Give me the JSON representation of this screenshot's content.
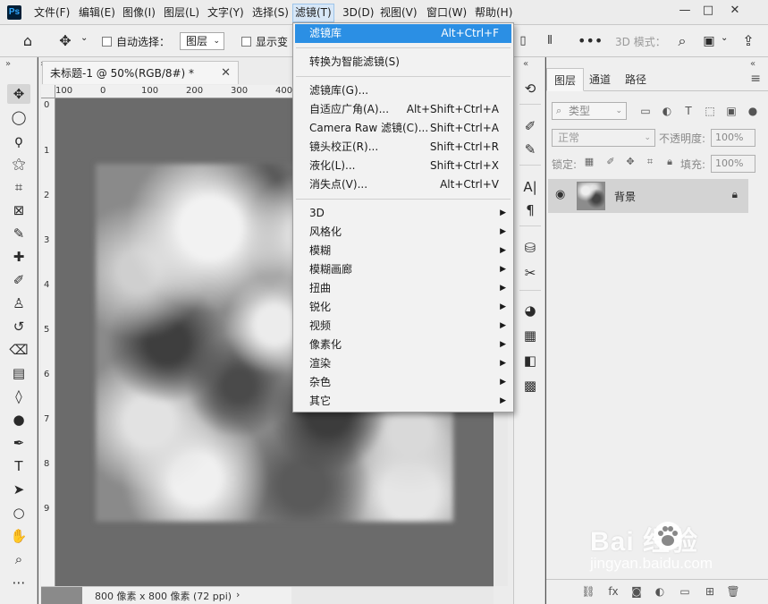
{
  "app": {
    "logo": "Ps"
  },
  "menubar": {
    "items": [
      "文件(F)",
      "编辑(E)",
      "图像(I)",
      "图层(L)",
      "文字(Y)",
      "选择(S)",
      "滤镜(T)",
      "3D(D)",
      "视图(V)",
      "窗口(W)",
      "帮助(H)"
    ],
    "active_index": 6,
    "window_buttons": {
      "minimize": "—",
      "restore": "□",
      "close": "✕"
    }
  },
  "options_bar": {
    "auto_select_label": "自动选择：",
    "layer_select_value": "图层",
    "show_transform_label": "显示变",
    "mode_3d_label": "3D 模式："
  },
  "document": {
    "tab_title": "未标题-1 @ 50%(RGB/8#) *",
    "ruler_top_labels": [
      "100",
      "0",
      "100",
      "200",
      "300",
      "400"
    ],
    "ruler_left_labels": [
      "0",
      "1",
      "2",
      "3",
      "4",
      "5",
      "6",
      "7",
      "8",
      "9"
    ],
    "status_text": "800 像素 x 800 像素 (72 ppi)"
  },
  "filter_menu": {
    "items": [
      {
        "label": "滤镜库",
        "shortcut": "Alt+Ctrl+F",
        "highlighted": true
      },
      {
        "label": "转换为智能滤镜(S)"
      },
      {
        "label": "滤镜库(G)..."
      },
      {
        "label": "自适应广角(A)...",
        "shortcut": "Alt+Shift+Ctrl+A"
      },
      {
        "label": "Camera Raw 滤镜(C)...",
        "shortcut": "Shift+Ctrl+A"
      },
      {
        "label": "镜头校正(R)...",
        "shortcut": "Shift+Ctrl+R"
      },
      {
        "label": "液化(L)...",
        "shortcut": "Shift+Ctrl+X"
      },
      {
        "label": "消失点(V)...",
        "shortcut": "Alt+Ctrl+V"
      },
      {
        "label": "3D",
        "submenu": true
      },
      {
        "label": "风格化",
        "submenu": true
      },
      {
        "label": "模糊",
        "submenu": true
      },
      {
        "label": "模糊画廊",
        "submenu": true
      },
      {
        "label": "扭曲",
        "submenu": true
      },
      {
        "label": "锐化",
        "submenu": true
      },
      {
        "label": "视频",
        "submenu": true
      },
      {
        "label": "像素化",
        "submenu": true
      },
      {
        "label": "渲染",
        "submenu": true
      },
      {
        "label": "杂色",
        "submenu": true
      },
      {
        "label": "其它",
        "submenu": true
      }
    ]
  },
  "layers_panel": {
    "tabs": [
      "图层",
      "通道",
      "路径"
    ],
    "filter_placeholder": "类型",
    "blend_mode": "正常",
    "opacity_label": "不透明度:",
    "opacity_value": "100%",
    "lock_label": "锁定:",
    "fill_label": "填充:",
    "fill_value": "100%",
    "layer_name": "背景"
  },
  "watermark": {
    "brand": "Bai  经验",
    "url": "jingyan.baidu.com"
  },
  "colors": {
    "highlight": "#2b8fe4",
    "canvas_gray": "#6b6b6b"
  }
}
